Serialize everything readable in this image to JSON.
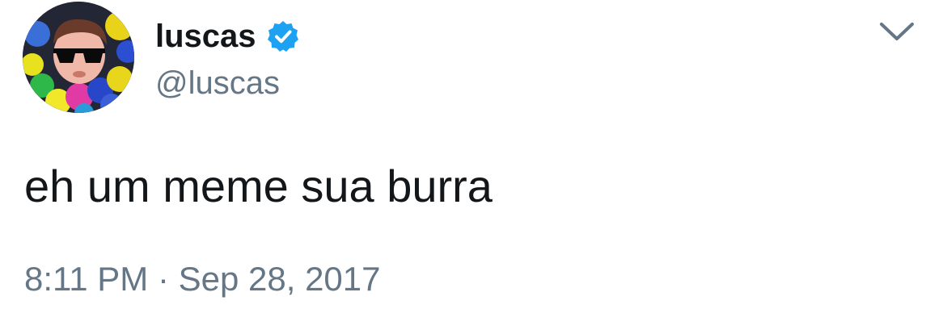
{
  "tweet": {
    "author": {
      "display_name": "luscas",
      "handle": "@luscas",
      "verified": true,
      "avatar": "avatar-photo"
    },
    "text": "eh um meme sua burra",
    "timestamp": "8:11 PM · Sep 28, 2017",
    "menu_icon": "chevron-down-icon",
    "verified_icon": "verified-badge-icon"
  },
  "colors": {
    "text_primary": "#14171a",
    "text_secondary": "#657786",
    "verified_blue": "#1da1f2",
    "chevron": "#657786"
  }
}
